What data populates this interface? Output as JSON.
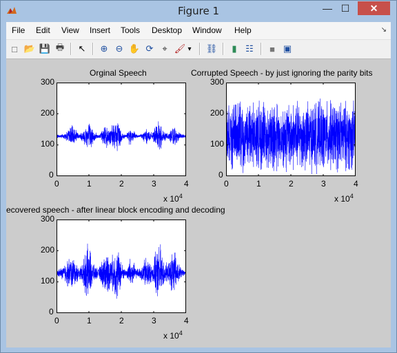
{
  "window": {
    "title": "Figure 1",
    "minimize_glyph": "—",
    "maximize_glyph": "☐",
    "close_glyph": "✕"
  },
  "menu": [
    "File",
    "Edit",
    "View",
    "Insert",
    "Tools",
    "Desktop",
    "Window",
    "Help"
  ],
  "menu_more_glyph": "↘",
  "toolbar": [
    {
      "name": "new-figure-icon",
      "glyph": "□"
    },
    {
      "name": "open-file-icon",
      "glyph": "📂"
    },
    {
      "name": "save-icon",
      "glyph": "💾"
    },
    {
      "name": "print-icon",
      "glyph": "🖶"
    },
    {
      "name": "edit-plot-arrow-icon",
      "glyph": "↖"
    },
    {
      "name": "zoom-in-icon",
      "glyph": "⊕"
    },
    {
      "name": "zoom-out-icon",
      "glyph": "⊖"
    },
    {
      "name": "pan-hand-icon",
      "glyph": "✋"
    },
    {
      "name": "rotate-3d-icon",
      "glyph": "⟳"
    },
    {
      "name": "data-cursor-icon",
      "glyph": "⌖"
    },
    {
      "name": "brush-icon",
      "glyph": "🖌"
    },
    {
      "name": "brush-dropdown-icon",
      "glyph": "▾"
    },
    {
      "name": "link-plot-icon",
      "glyph": "⛓"
    },
    {
      "name": "colorbar-icon",
      "glyph": "▮"
    },
    {
      "name": "legend-icon",
      "glyph": "☷"
    },
    {
      "name": "hide-plot-tools-icon",
      "glyph": "■"
    },
    {
      "name": "show-plot-tools-icon",
      "glyph": "▣"
    }
  ],
  "colors": {
    "line": "#0000ff",
    "figure_bg": "#cccccc",
    "axes_bg": "#ffffff"
  },
  "chart_data": [
    {
      "type": "line",
      "title": "Orginal Speech",
      "xlim": [
        0,
        40000
      ],
      "ylim": [
        0,
        300
      ],
      "x_ticks": [
        "0",
        "1",
        "2",
        "3",
        "4"
      ],
      "y_ticks": [
        "0",
        "100",
        "200",
        "300"
      ],
      "x_multiplier": "x 10",
      "x_multiplier_exp": "4",
      "series": [
        {
          "baseline": 128,
          "envelope": [
            [
              0,
              6
            ],
            [
              2000,
              8
            ],
            [
              3500,
              20
            ],
            [
              4500,
              40
            ],
            [
              6000,
              25
            ],
            [
              7000,
              8
            ],
            [
              8500,
              28
            ],
            [
              9500,
              55
            ],
            [
              10500,
              50
            ],
            [
              11500,
              18
            ],
            [
              13000,
              6
            ],
            [
              14500,
              30
            ],
            [
              15500,
              45
            ],
            [
              16500,
              32
            ],
            [
              17500,
              40
            ],
            [
              18500,
              60
            ],
            [
              19500,
              45
            ],
            [
              20500,
              12
            ],
            [
              21500,
              5
            ],
            [
              22500,
              30
            ],
            [
              23500,
              28
            ],
            [
              24500,
              8
            ],
            [
              25500,
              6
            ],
            [
              26500,
              12
            ],
            [
              27500,
              30
            ],
            [
              28500,
              25
            ],
            [
              29500,
              10
            ],
            [
              31000,
              45
            ],
            [
              32000,
              55
            ],
            [
              33000,
              20
            ],
            [
              34500,
              12
            ],
            [
              35500,
              30
            ],
            [
              36500,
              35
            ],
            [
              37500,
              18
            ],
            [
              38500,
              8
            ],
            [
              40000,
              5
            ]
          ]
        }
      ]
    },
    {
      "type": "line",
      "title": "Corrupted Speech - by just ignoring the parity bits",
      "xlim": [
        0,
        40000
      ],
      "ylim": [
        0,
        300
      ],
      "x_ticks": [
        "0",
        "1",
        "2",
        "3",
        "4"
      ],
      "y_ticks": [
        "0",
        "100",
        "200",
        "300"
      ],
      "x_multiplier": "x 10",
      "x_multiplier_exp": "4",
      "series": [
        {
          "baseline": 128,
          "envelope": [
            [
              0,
              125
            ],
            [
              40000,
              125
            ]
          ]
        }
      ]
    },
    {
      "type": "line",
      "title": "ecovered speech - after linear block encoding and decoding",
      "xlim": [
        0,
        40000
      ],
      "ylim": [
        0,
        300
      ],
      "x_ticks": [
        "0",
        "1",
        "2",
        "3",
        "4"
      ],
      "y_ticks": [
        "0",
        "100",
        "200",
        "300"
      ],
      "x_multiplier": "x 10",
      "x_multiplier_exp": "4",
      "series": [
        {
          "baseline": 128,
          "envelope": [
            [
              0,
              10
            ],
            [
              1500,
              20
            ],
            [
              3000,
              45
            ],
            [
              4500,
              60
            ],
            [
              6000,
              45
            ],
            [
              7000,
              15
            ],
            [
              8500,
              55
            ],
            [
              9500,
              100
            ],
            [
              10500,
              80
            ],
            [
              11500,
              30
            ],
            [
              13000,
              15
            ],
            [
              14500,
              60
            ],
            [
              15500,
              80
            ],
            [
              16500,
              55
            ],
            [
              17500,
              65
            ],
            [
              18500,
              100
            ],
            [
              19500,
              70
            ],
            [
              20500,
              25
            ],
            [
              21500,
              10
            ],
            [
              22500,
              55
            ],
            [
              23500,
              50
            ],
            [
              24500,
              20
            ],
            [
              25500,
              15
            ],
            [
              26500,
              35
            ],
            [
              27500,
              60
            ],
            [
              28500,
              50
            ],
            [
              29500,
              25
            ],
            [
              31000,
              90
            ],
            [
              32000,
              110
            ],
            [
              33000,
              45
            ],
            [
              34500,
              30
            ],
            [
              35500,
              70
            ],
            [
              36500,
              80
            ],
            [
              37500,
              40
            ],
            [
              38500,
              20
            ],
            [
              40000,
              10
            ]
          ]
        }
      ]
    }
  ]
}
